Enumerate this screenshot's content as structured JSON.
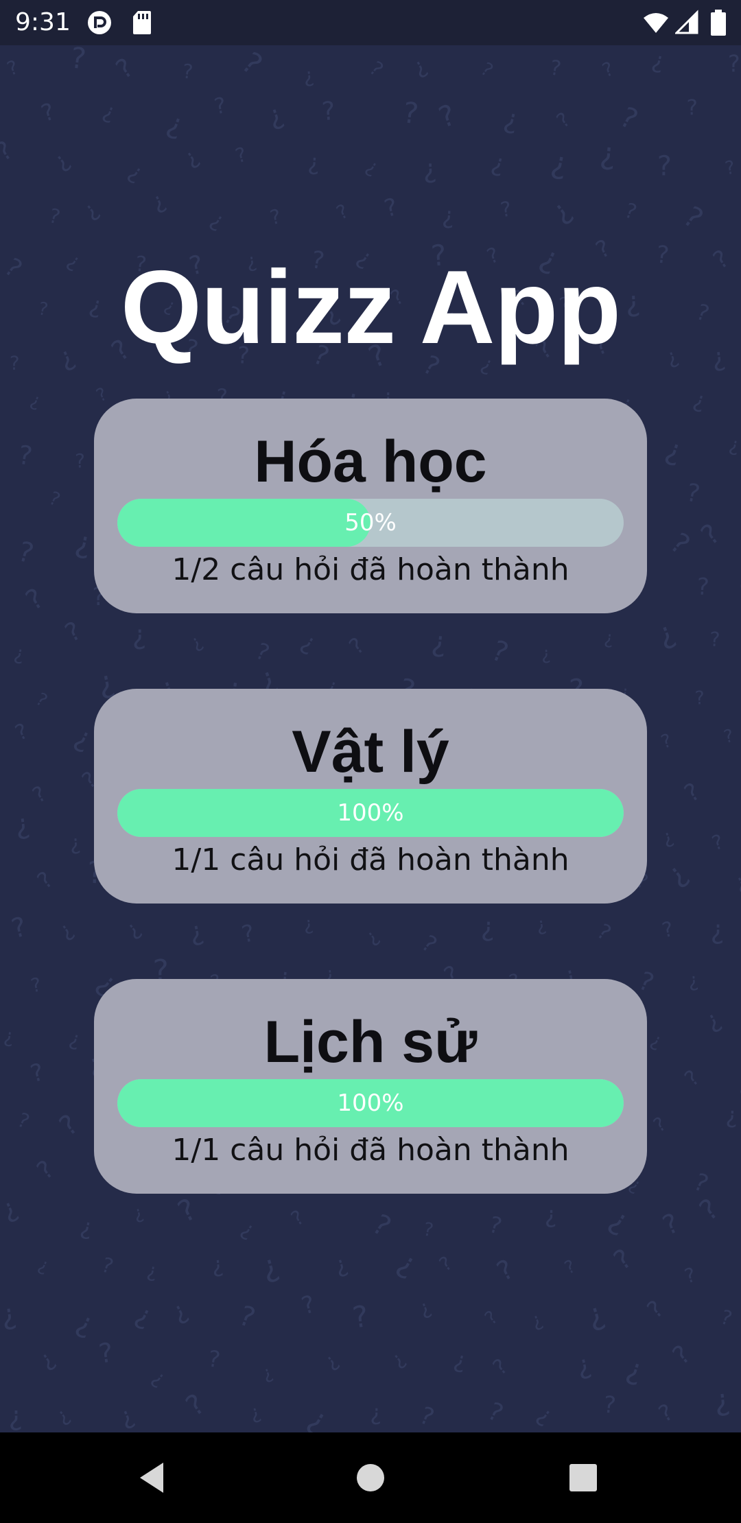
{
  "status_bar": {
    "time": "9:31",
    "icons": [
      "app-notification-icon",
      "sd-card-icon",
      "wifi-icon",
      "cell-signal-icon",
      "battery-icon"
    ]
  },
  "app": {
    "title": "Quizz App"
  },
  "quizzes": [
    {
      "name": "Hóa học",
      "progress_percent": 50,
      "progress_label": "50%",
      "completion_label": "1/2 câu hỏi đã hoàn thành"
    },
    {
      "name": "Vật lý",
      "progress_percent": 100,
      "progress_label": "100%",
      "completion_label": "1/1 câu hỏi đã hoàn thành"
    },
    {
      "name": "Lịch sử",
      "progress_percent": 100,
      "progress_label": "100%",
      "completion_label": "1/1 câu hỏi đã hoàn thành"
    }
  ],
  "navigation": {
    "buttons": [
      "back-icon",
      "home-icon",
      "recents-icon"
    ]
  },
  "colors": {
    "background": "#252b49",
    "card": "#a5a6b5",
    "progress_fill": "#67efb0",
    "progress_track": "#b5c7cc"
  }
}
